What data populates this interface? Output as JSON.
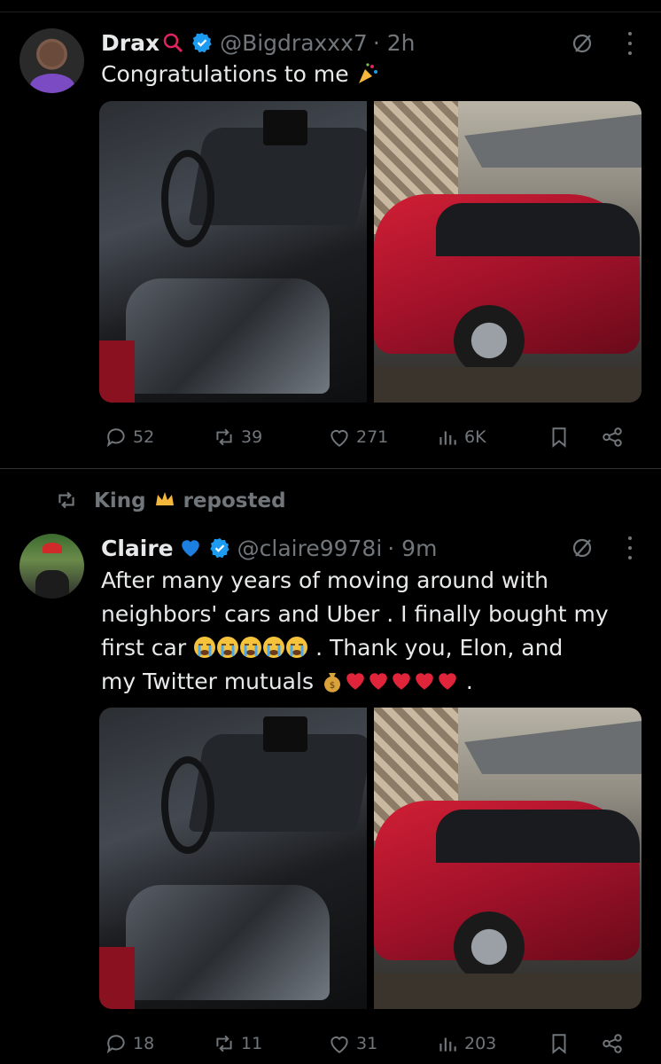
{
  "tweet1": {
    "display_name": "Drax",
    "handle": "@Bigdraxxx7",
    "time": "· 2h",
    "text": "Congratulations to me",
    "stats": {
      "replies": "52",
      "reposts": "39",
      "likes": "271",
      "views": "6K"
    }
  },
  "repost_banner": {
    "user": "King",
    "label": "reposted"
  },
  "tweet2": {
    "display_name": "Claire",
    "handle": "@claire9978i",
    "time": "· 9m",
    "text_line1": "After many years of moving around with",
    "text_line2": "neighbors' cars and Uber . I finally bought my",
    "text_line3a": "first car",
    "text_line3b": ". Thank you, Elon, and",
    "text_line4a": "my Twitter mutuals",
    "text_line4b": ".",
    "stats": {
      "replies": "18",
      "reposts": "11",
      "likes": "31",
      "views": "203"
    }
  },
  "colors": {
    "background": "#000000",
    "text": "#e7e9ea",
    "muted": "#71767b",
    "verified": "#1d9bf0",
    "heart": "#e0245e"
  },
  "icons": [
    "reply-icon",
    "repost-icon",
    "like-icon",
    "views-icon",
    "bookmark-icon",
    "share-icon",
    "grok-icon",
    "more-icon",
    "verified-badge-icon"
  ]
}
